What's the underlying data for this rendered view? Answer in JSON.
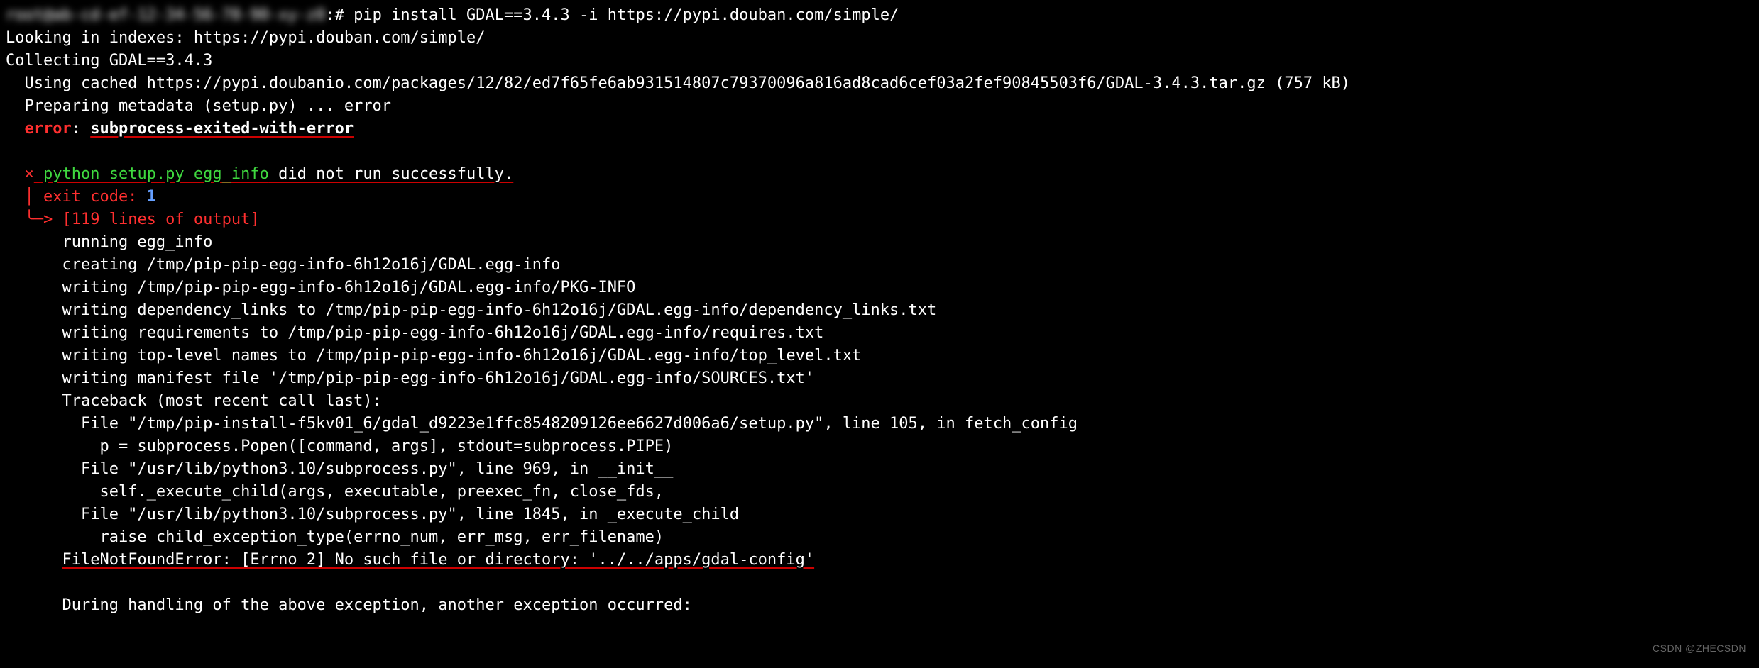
{
  "prompt": {
    "blurred_prefix": "root@ab-cd-ef-12-34-56-78-90-xy-z0",
    "suffix": ":#",
    "command": " pip install GDAL==3.4.3 -i https://pypi.douban.com/simple/"
  },
  "lines": {
    "l1": "Looking in indexes: https://pypi.douban.com/simple/",
    "l2": "Collecting GDAL==3.4.3",
    "l3": "  Using cached https://pypi.doubanio.com/packages/12/82/ed7f65fe6ab931514807c79370096a816ad8cad6cef03a2fef90845503f6/GDAL-3.4.3.tar.gz (757 kB)",
    "l4": "  Preparing metadata (setup.py) ... error",
    "err_label": "  error",
    "err_colon": ": ",
    "err_name": "subprocess-exited-with-error",
    "blank1": "",
    "x": "  ×",
    "setup_green": " python setup.py egg_info",
    "setup_rest": " did not run successfully.",
    "exit_pre": "  │ exit code: ",
    "exit_code": "1",
    "arrow": "  ╰─>",
    "arrow_rest": " [119 lines of output]",
    "o1": "      running egg_info",
    "o2": "      creating /tmp/pip-pip-egg-info-6h12o16j/GDAL.egg-info",
    "o3": "      writing /tmp/pip-pip-egg-info-6h12o16j/GDAL.egg-info/PKG-INFO",
    "o4": "      writing dependency_links to /tmp/pip-pip-egg-info-6h12o16j/GDAL.egg-info/dependency_links.txt",
    "o5": "      writing requirements to /tmp/pip-pip-egg-info-6h12o16j/GDAL.egg-info/requires.txt",
    "o6": "      writing top-level names to /tmp/pip-pip-egg-info-6h12o16j/GDAL.egg-info/top_level.txt",
    "o7": "      writing manifest file '/tmp/pip-pip-egg-info-6h12o16j/GDAL.egg-info/SOURCES.txt'",
    "o8": "      Traceback (most recent call last):",
    "o9": "        File \"/tmp/pip-install-f5kv01_6/gdal_d9223e1ffc8548209126ee6627d006a6/setup.py\", line 105, in fetch_config",
    "o10": "          p = subprocess.Popen([command, args], stdout=subprocess.PIPE)",
    "o11": "        File \"/usr/lib/python3.10/subprocess.py\", line 969, in __init__",
    "o12": "          self._execute_child(args, executable, preexec_fn, close_fds,",
    "o13": "        File \"/usr/lib/python3.10/subprocess.py\", line 1845, in _execute_child",
    "o14": "          raise child_exception_type(errno_num, err_msg, err_filename)",
    "fnf_pre": "      ",
    "fnf": "FileNotFoundError: [Errno 2] No such file or directory: '../../apps/gdal-config'",
    "blank2": "",
    "o15": "      During handling of the above exception, another exception occurred:"
  },
  "watermark": "CSDN @ZHECSDN"
}
